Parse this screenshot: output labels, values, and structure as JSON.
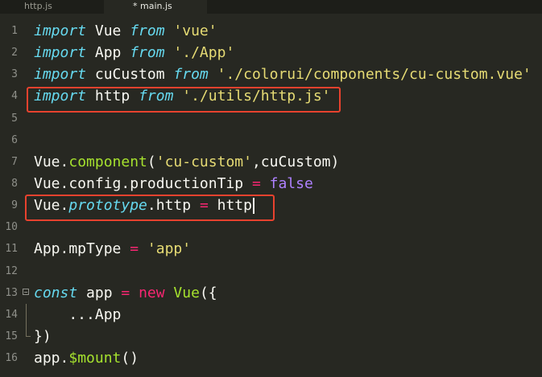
{
  "tabs": [
    {
      "label": "http.js",
      "active": false
    },
    {
      "label": "* main.js",
      "active": true
    }
  ],
  "colors": {
    "background": "#272822",
    "keyword": "#66d9ef",
    "string": "#e6db74",
    "function": "#a6e22e",
    "operator": "#f92672",
    "boolean": "#ae81ff",
    "highlight_box": "#e8422e"
  },
  "lines": [
    {
      "num": "1",
      "tokens": [
        {
          "t": "import",
          "c": "kw"
        },
        {
          "t": " Vue ",
          "c": "plain"
        },
        {
          "t": "from",
          "c": "kw"
        },
        {
          "t": " ",
          "c": "plain"
        },
        {
          "t": "'vue'",
          "c": "str"
        }
      ]
    },
    {
      "num": "2",
      "tokens": [
        {
          "t": "import",
          "c": "kw"
        },
        {
          "t": " App ",
          "c": "plain"
        },
        {
          "t": "from",
          "c": "kw"
        },
        {
          "t": " ",
          "c": "plain"
        },
        {
          "t": "'./App'",
          "c": "str"
        }
      ]
    },
    {
      "num": "3",
      "tokens": [
        {
          "t": "import",
          "c": "kw"
        },
        {
          "t": " cuCustom ",
          "c": "plain"
        },
        {
          "t": "from",
          "c": "kw"
        },
        {
          "t": " ",
          "c": "plain"
        },
        {
          "t": "'./colorui/components/cu-custom.vue'",
          "c": "str"
        }
      ]
    },
    {
      "num": "4",
      "tokens": [
        {
          "t": "import",
          "c": "kw"
        },
        {
          "t": " http ",
          "c": "plain"
        },
        {
          "t": "from",
          "c": "kw"
        },
        {
          "t": " ",
          "c": "plain"
        },
        {
          "t": "'./utils/http.js'",
          "c": "str"
        }
      ]
    },
    {
      "num": "5",
      "tokens": []
    },
    {
      "num": "6",
      "tokens": []
    },
    {
      "num": "7",
      "tokens": [
        {
          "t": "Vue.",
          "c": "plain"
        },
        {
          "t": "component",
          "c": "fn"
        },
        {
          "t": "(",
          "c": "plain"
        },
        {
          "t": "'cu-custom'",
          "c": "str"
        },
        {
          "t": ",cuCustom)",
          "c": "plain"
        }
      ]
    },
    {
      "num": "8",
      "tokens": [
        {
          "t": "Vue.config.productionTip ",
          "c": "plain"
        },
        {
          "t": "=",
          "c": "op"
        },
        {
          "t": " ",
          "c": "plain"
        },
        {
          "t": "false",
          "c": "bool"
        }
      ]
    },
    {
      "num": "9",
      "tokens": [
        {
          "t": "Vue.",
          "c": "plain"
        },
        {
          "t": "prototype",
          "c": "kw"
        },
        {
          "t": ".http ",
          "c": "plain"
        },
        {
          "t": "=",
          "c": "op"
        },
        {
          "t": " http",
          "c": "plain"
        }
      ],
      "cursor": true
    },
    {
      "num": "10",
      "tokens": []
    },
    {
      "num": "11",
      "tokens": [
        {
          "t": "App.mpType ",
          "c": "plain"
        },
        {
          "t": "=",
          "c": "op"
        },
        {
          "t": " ",
          "c": "plain"
        },
        {
          "t": "'app'",
          "c": "str"
        }
      ]
    },
    {
      "num": "12",
      "tokens": []
    },
    {
      "num": "13",
      "tokens": [
        {
          "t": "const",
          "c": "kw"
        },
        {
          "t": " app ",
          "c": "plain"
        },
        {
          "t": "=",
          "c": "op"
        },
        {
          "t": " ",
          "c": "plain"
        },
        {
          "t": "new",
          "c": "op"
        },
        {
          "t": " ",
          "c": "plain"
        },
        {
          "t": "Vue",
          "c": "fn"
        },
        {
          "t": "({",
          "c": "plain"
        }
      ],
      "fold": true
    },
    {
      "num": "14",
      "tokens": [
        {
          "t": "    ...App",
          "c": "plain"
        }
      ],
      "guide": "mid"
    },
    {
      "num": "15",
      "tokens": [
        {
          "t": "})",
          "c": "plain"
        }
      ],
      "guide": "end"
    },
    {
      "num": "16",
      "tokens": [
        {
          "t": "app.",
          "c": "plain"
        },
        {
          "t": "$mount",
          "c": "fn"
        },
        {
          "t": "()",
          "c": "plain"
        }
      ]
    }
  ]
}
